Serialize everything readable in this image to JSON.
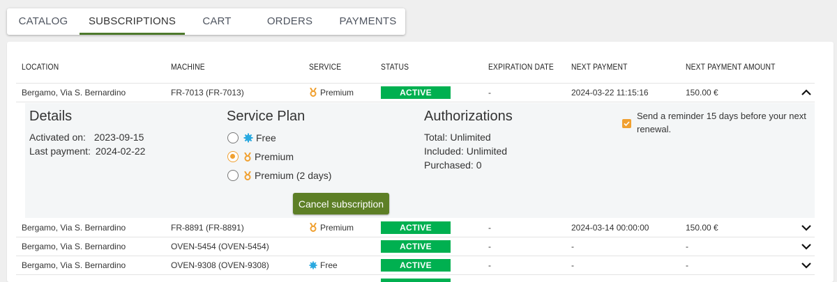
{
  "tabs": [
    {
      "label": "CATALOG"
    },
    {
      "label": "SUBSCRIPTIONS",
      "active": true
    },
    {
      "label": "CART"
    },
    {
      "label": "ORDERS"
    },
    {
      "label": "PAYMENTS"
    }
  ],
  "table": {
    "columns": [
      "LOCATION",
      "MACHINE",
      "SERVICE",
      "STATUS",
      "EXPIRATION DATE",
      "NEXT PAYMENT",
      "NEXT PAYMENT AMOUNT"
    ],
    "rows": [
      {
        "location": "Bergamo, Via S. Bernardino",
        "machine": "FR-7013 (FR-7013)",
        "service": "Premium",
        "service_icon": "medal-icon",
        "status": "ACTIVE",
        "expiration": "-",
        "next_payment": "2024-03-22 11:15:16",
        "amount": "150.00 €",
        "expanded": true
      },
      {
        "location": "Bergamo, Via S. Bernardino",
        "machine": "FR-8891 (FR-8891)",
        "service": "Premium",
        "service_icon": "medal-icon",
        "status": "ACTIVE",
        "expiration": "-",
        "next_payment": "2024-03-14 00:00:00",
        "amount": "150.00 €",
        "expanded": false
      },
      {
        "location": "Bergamo, Via S. Bernardino",
        "machine": "OVEN-5454 (OVEN-5454)",
        "service": "",
        "service_icon": "",
        "status": "ACTIVE",
        "expiration": "-",
        "next_payment": "-",
        "amount": "-",
        "expanded": false
      },
      {
        "location": "Bergamo, Via S. Bernardino",
        "machine": "OVEN-9308 (OVEN-9308)",
        "service": "Free",
        "service_icon": "badge-icon",
        "status": "ACTIVE",
        "expiration": "-",
        "next_payment": "-",
        "amount": "-",
        "expanded": false
      }
    ]
  },
  "details": {
    "title": "Details",
    "activated_label": "Activated on:",
    "activated_value": "2023-09-15",
    "last_payment_label": "Last payment:",
    "last_payment_value": "2024-02-22",
    "plan_title": "Service Plan",
    "plans": [
      {
        "label": "Free",
        "icon": "badge-icon",
        "selected": false
      },
      {
        "label": "Premium",
        "icon": "medal-icon",
        "selected": true
      },
      {
        "label": "Premium (2 days)",
        "icon": "medal-icon",
        "selected": false
      }
    ],
    "cancel_label": "Cancel subscription",
    "auth_title": "Authorizations",
    "auth_total": "Total: Unlimited",
    "auth_included": "Included: Unlimited",
    "auth_purchased": "Purchased: 0",
    "reminder_text": "Send a reminder 15 days before your next renewal.",
    "reminder_checked": true
  },
  "colors": {
    "accent": "#4e7a2c",
    "active_badge": "#00b050",
    "premium_icon": "#f0a030",
    "free_icon": "#2aa9e0",
    "cancel_button": "#5d7f26"
  }
}
